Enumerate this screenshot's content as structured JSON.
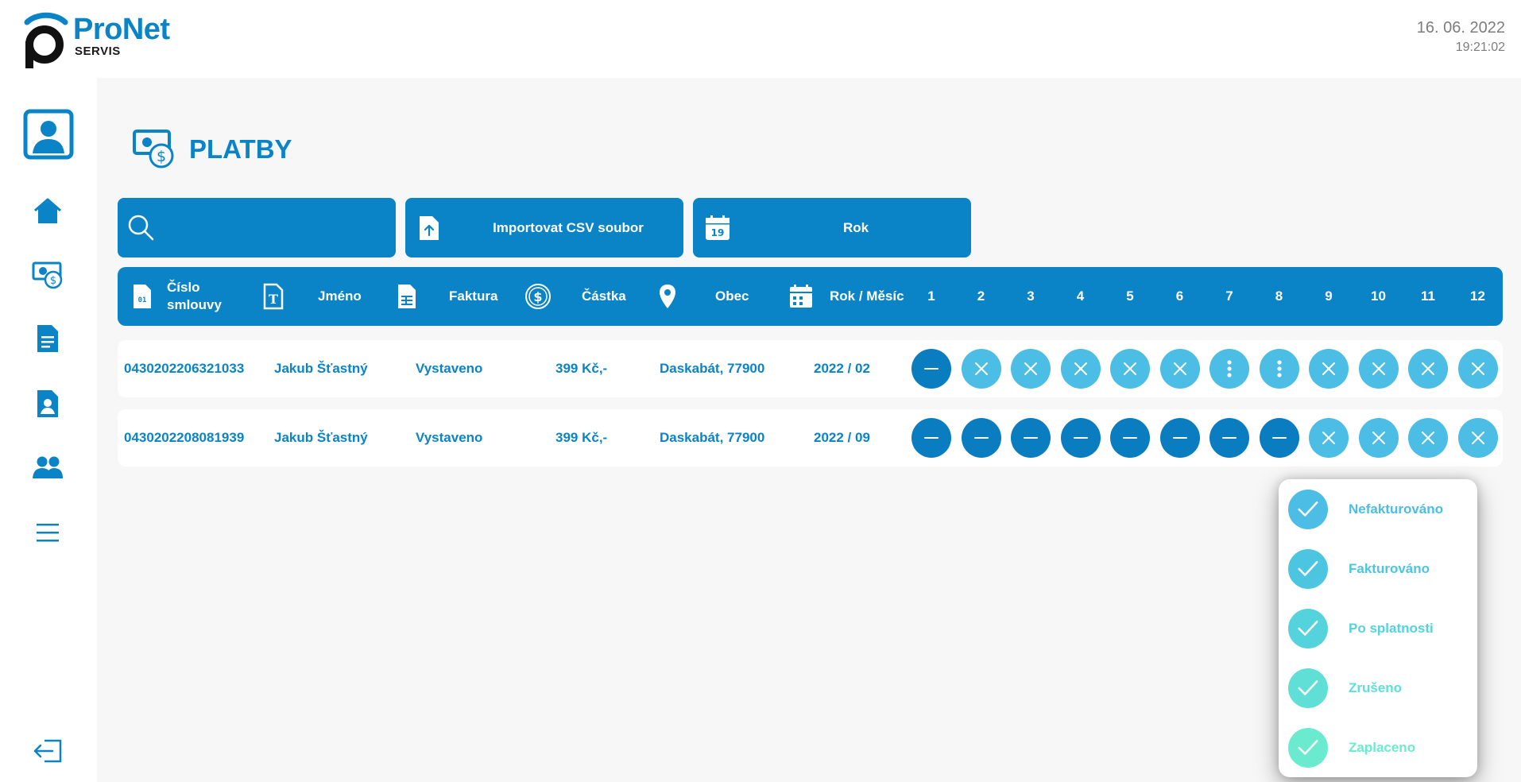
{
  "brand": {
    "name": "ProNet",
    "sub": "SERVIS"
  },
  "datetime": {
    "date": "16. 06. 2022",
    "time": "19:21:02"
  },
  "page": {
    "title": "PLATBY"
  },
  "toolbar": {
    "search_placeholder": "",
    "import_label": "Importovat CSV soubor",
    "year_label": "Rok",
    "calendar_day": "19"
  },
  "table": {
    "headers": {
      "contract_line1": "Číslo",
      "contract_line2": "smlouvy",
      "contract_icon_text": "01",
      "name": "Jméno",
      "invoice": "Faktura",
      "amount": "Částka",
      "city": "Obec",
      "year_month": "Rok / Měsíc"
    },
    "months": [
      "1",
      "2",
      "3",
      "4",
      "5",
      "6",
      "7",
      "8",
      "9",
      "10",
      "11",
      "12"
    ],
    "rows": [
      {
        "contract": "0430202206321033",
        "name": "Jakub Šťastný",
        "invoice": "Vystaveno",
        "amount": "399 Kč,-",
        "city": "Daskabát, 77900",
        "year_month": "2022 / 02",
        "months": [
          "dash",
          "x",
          "x",
          "x",
          "x",
          "x",
          "dots",
          "dots",
          "x",
          "x",
          "x",
          "x"
        ]
      },
      {
        "contract": "0430202208081939",
        "name": "Jakub Šťastný",
        "invoice": "Vystaveno",
        "amount": "399 Kč,-",
        "city": "Daskabát, 77900",
        "year_month": "2022 / 09",
        "months": [
          "dash",
          "dash",
          "dash",
          "dash",
          "dash",
          "dash",
          "dash",
          "dash",
          "x",
          "x",
          "x",
          "x"
        ]
      }
    ]
  },
  "status_popup": {
    "items": [
      {
        "label": "Nefakturováno",
        "color": "#4cbde4"
      },
      {
        "label": "Fakturováno",
        "color": "#4cc6e0"
      },
      {
        "label": "Po splatnosti",
        "color": "#55d3dd"
      },
      {
        "label": "Zrušeno",
        "color": "#5fdfd6"
      },
      {
        "label": "Zaplaceno",
        "color": "#6aebd0"
      }
    ]
  },
  "colors": {
    "primary": "#0a84c6",
    "dark_button": "#0a7cc0",
    "light_button": "#4cbde4"
  }
}
